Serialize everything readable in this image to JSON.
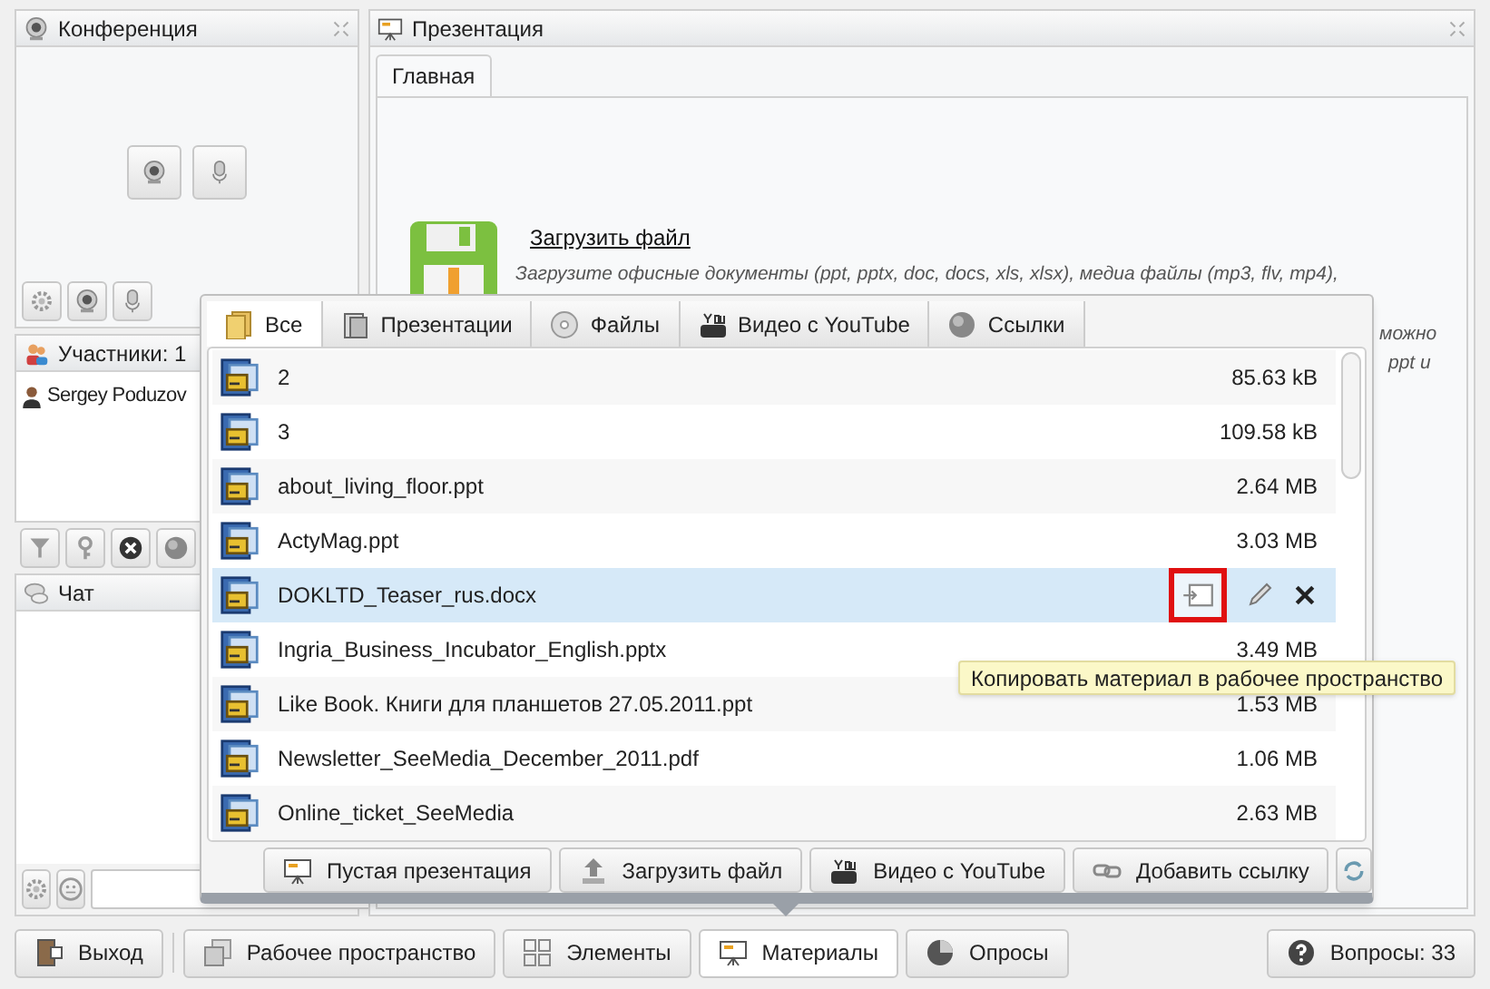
{
  "conference": {
    "title": "Конференция"
  },
  "participants": {
    "title": "Участники: 1",
    "items": [
      {
        "name": "Sergey Poduzov"
      }
    ]
  },
  "chat": {
    "title": "Чат"
  },
  "presentation": {
    "title": "Презентация",
    "tabs": [
      {
        "label": "Главная",
        "selected": true
      }
    ],
    "upload_link": "Загрузить файл",
    "description": [
      "Загрузите офисные документы (ppt, pptx, doc, docs, xls, xlsx), медиа файлы (mp3, flv, mp4),",
      "можно",
      "ppt и"
    ]
  },
  "materials": {
    "tabs": [
      {
        "label": "Все",
        "selected": true
      },
      {
        "label": "Презентации",
        "selected": false
      },
      {
        "label": "Файлы",
        "selected": false
      },
      {
        "label": "Видео с YouTube",
        "selected": false
      },
      {
        "label": "Ссылки",
        "selected": false
      }
    ],
    "files": [
      {
        "name": "2",
        "size": "85.63 kB",
        "selected": false
      },
      {
        "name": "3",
        "size": "109.58 kB",
        "selected": false
      },
      {
        "name": "about_living_floor.ppt",
        "size": "2.64 MB",
        "selected": false
      },
      {
        "name": "ActyMag.ppt",
        "size": "3.03 MB",
        "selected": false
      },
      {
        "name": "DOKLTD_Teaser_rus.docx",
        "selected": true
      },
      {
        "name": "Ingria_Business_Incubator_English.pptx",
        "size": "3.49 MB",
        "selected": false
      },
      {
        "name": "Like Book. Книги для планшетов 27.05.2011.ppt",
        "size": "1.53 MB",
        "selected": false
      },
      {
        "name": "Newsletter_SeeMedia_December_2011.pdf",
        "size": "1.06 MB",
        "selected": false
      },
      {
        "name": "Online_ticket_SeeMedia",
        "size": "2.63 MB",
        "selected": false
      }
    ],
    "buttons": [
      "Пустая презентация",
      "Загрузить файл",
      "Видео с YouTube",
      "Добавить ссылку"
    ],
    "tooltip": "Копировать материал в рабочее пространство"
  },
  "bottom_bar": {
    "items": [
      {
        "label": "Выход",
        "selected": false
      },
      {
        "label": "Рабочее пространство",
        "selected": false
      },
      {
        "label": "Элементы",
        "selected": false
      },
      {
        "label": "Материалы",
        "selected": true
      },
      {
        "label": "Опросы",
        "selected": false
      }
    ],
    "questions": "Вопросы: 33"
  }
}
